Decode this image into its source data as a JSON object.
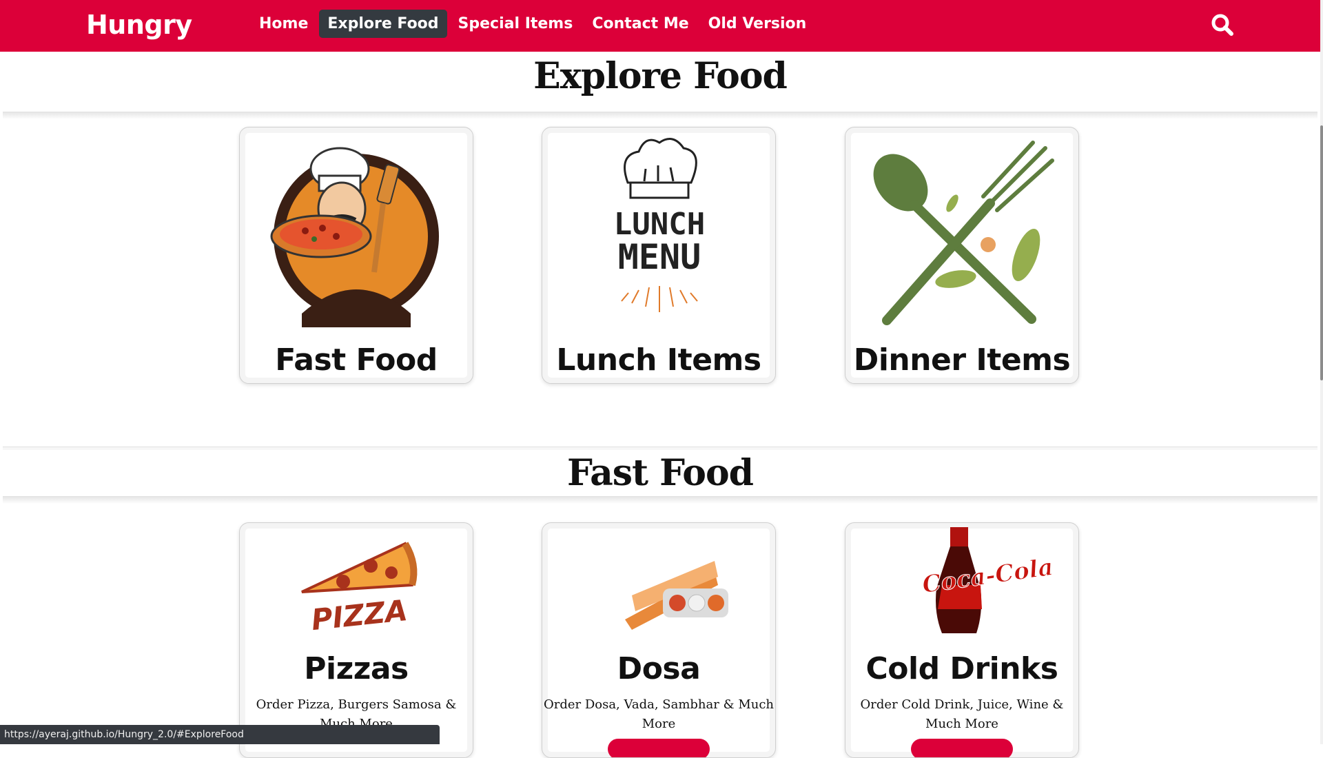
{
  "nav": {
    "brand": "Hungry",
    "links": [
      "Home",
      "Explore Food",
      "Special Items",
      "Contact Me",
      "Old Version"
    ],
    "active_link": "Explore Food",
    "search_icon": "search-icon"
  },
  "explore": {
    "heading": "Explore Food",
    "cards": [
      {
        "title": "Fast Food",
        "icon": "chef-with-pizza-logo"
      },
      {
        "title": "Lunch Items",
        "icon": "lunch-menu-chef-hat",
        "image_text": [
          "LUNCH",
          "MENU"
        ]
      },
      {
        "title": "Dinner Items",
        "icon": "spoon-fork-crossed-icon"
      }
    ]
  },
  "fast_food": {
    "heading": "Fast Food",
    "cards": [
      {
        "title": "Pizzas",
        "description": "Order Pizza, Burgers Samosa & Much More",
        "icon": "pizza-slice",
        "image_text": "PIZZA"
      },
      {
        "title": "Dosa",
        "description": "Order Dosa, Vada, Sambhar & Much More",
        "icon": "dosa-plate"
      },
      {
        "title": "Cold Drinks",
        "description": "Order Cold Drink, Juice, Wine & Much More",
        "icon": "coca-cola-bottle",
        "image_text": "Coca-Cola"
      }
    ]
  },
  "status_bar": {
    "url": "https://ayeraj.github.io/Hungry_2.0/#ExploreFood"
  },
  "colors": {
    "brand_red": "#dc0039",
    "active_nav": "#343a40",
    "olive_green": "#5e7d3e"
  }
}
